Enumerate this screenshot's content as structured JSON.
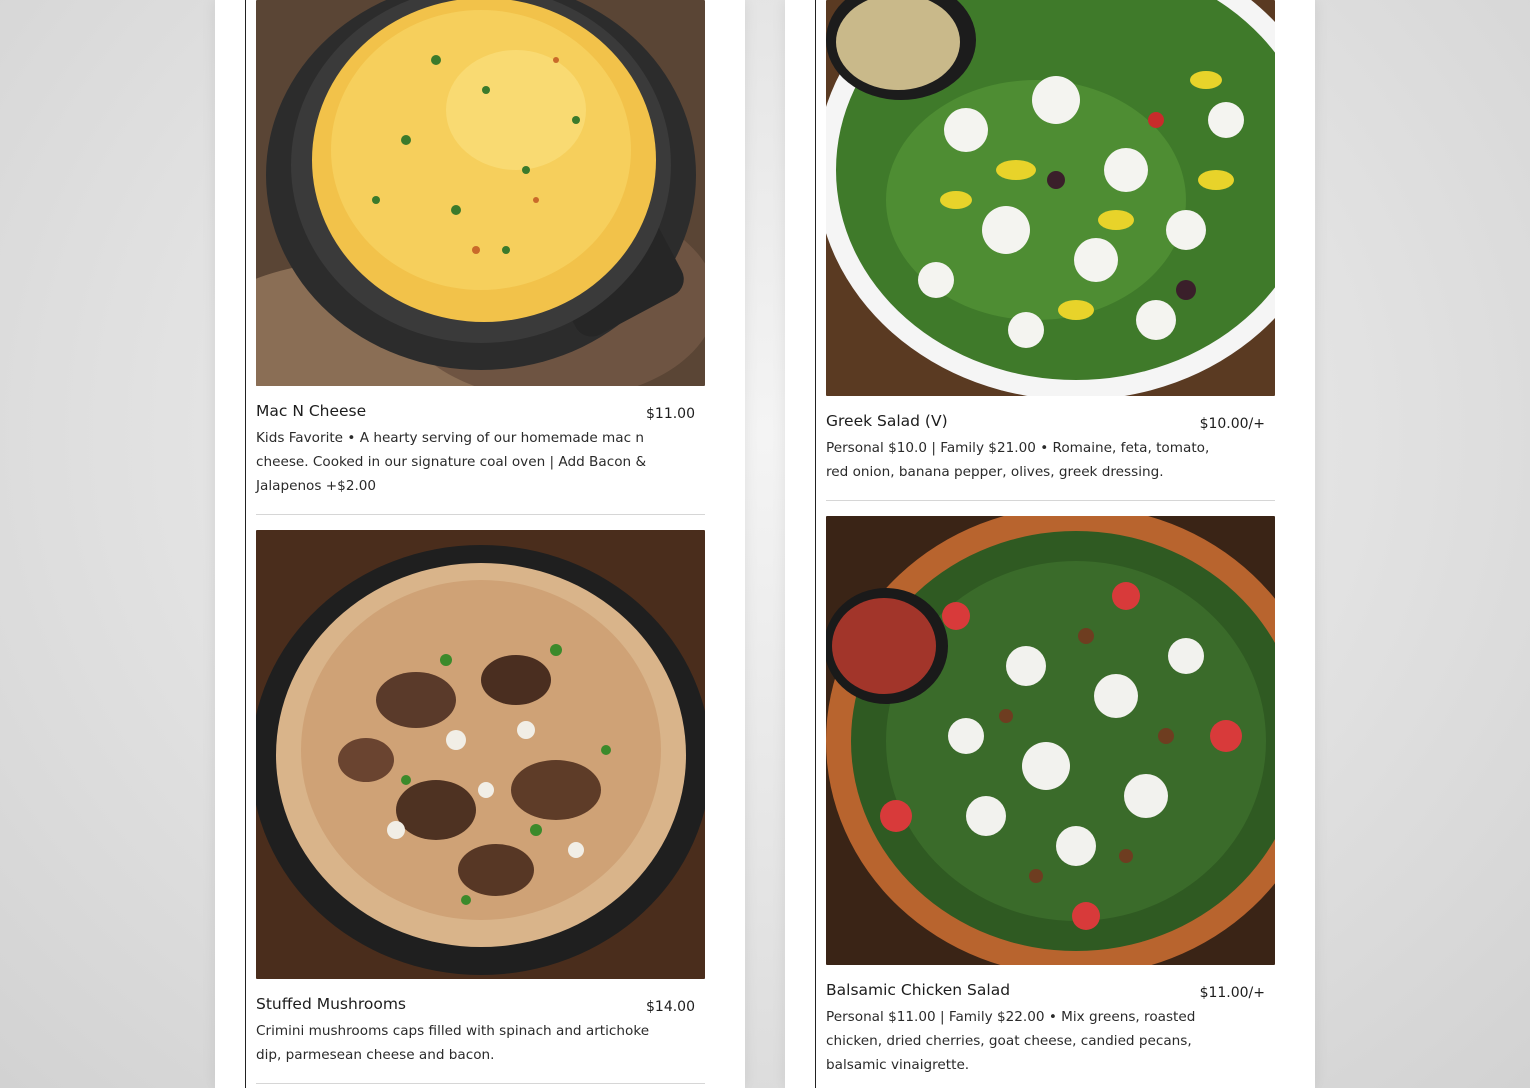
{
  "menu": {
    "left_column": [
      {
        "name": "Mac N Cheese",
        "price": "$11.00",
        "description": "Kids Favorite • A hearty serving of our homemade mac n cheese. Cooked in our signature coal oven | Add Bacon & Jalapenos +$2.00",
        "image": "mac-n-cheese-photo"
      },
      {
        "name": "Stuffed Mushrooms",
        "price": "$14.00",
        "description": "Crimini mushrooms caps filled with spinach and artichoke dip, parmesean cheese and bacon.",
        "image": "stuffed-mushrooms-photo"
      }
    ],
    "right_column": [
      {
        "name": "Greek Salad (V)",
        "price": "$10.00/+",
        "description": "Personal $10.0 | Family $21.00 • Romaine, feta, tomato, red onion, banana pepper, olives, greek dressing.",
        "image": "greek-salad-photo"
      },
      {
        "name": "Balsamic Chicken Salad",
        "price": "$11.00/+",
        "description": "Personal $11.00 | Family $22.00 • Mix greens, roasted chicken, dried cherries, goat cheese, candied pecans, balsamic vinaigrette.",
        "image": "balsamic-chicken-salad-photo"
      }
    ]
  },
  "colors": {
    "page_background": "#e2e2e2",
    "panel_background": "#ffffff",
    "divider": "#d6d6d6",
    "text": "#1d1d1d"
  }
}
